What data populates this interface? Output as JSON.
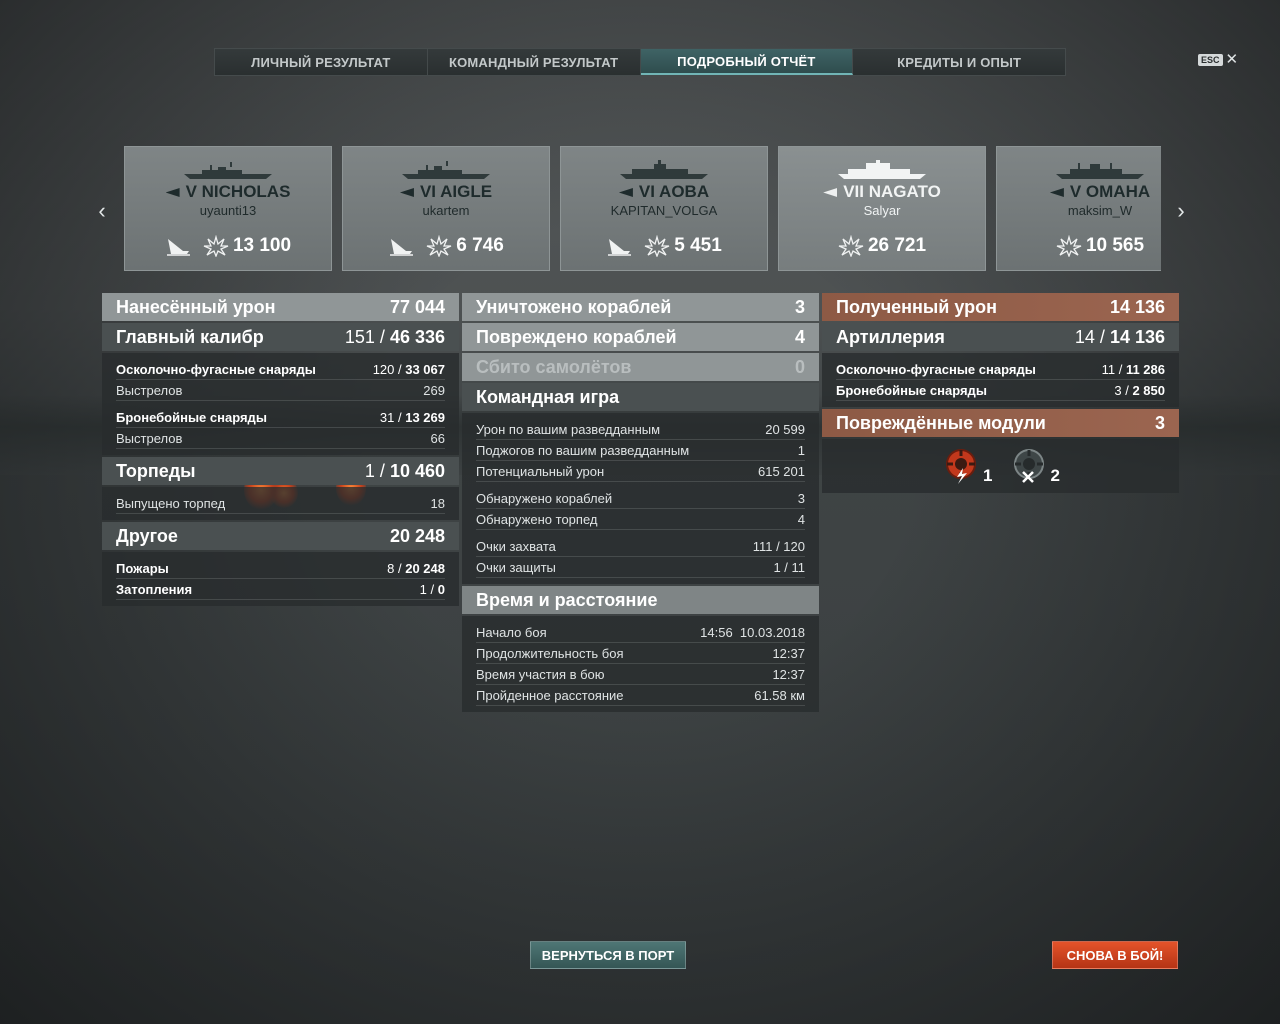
{
  "tabs": [
    "ЛИЧНЫЙ РЕЗУЛЬТАТ",
    "КОМАНДНЫЙ РЕЗУЛЬТАТ",
    "ПОДРОБНЫЙ ОТЧЁТ",
    "КРЕДИТЫ И ОПЫТ"
  ],
  "active_tab": "ПОДРОБНЫЙ ОТЧЁТ",
  "esc_label": "ESC",
  "ships": [
    {
      "name": "V NICHOLAS",
      "player": "uyaunti13",
      "damage": "13 100"
    },
    {
      "name": "VI AIGLE",
      "player": "ukartem",
      "damage": "6 746"
    },
    {
      "name": "VI AOBA",
      "player": "KAPITAN_VOLGA",
      "damage": "5 451"
    },
    {
      "name": "VII NAGATO",
      "player": "Salyar",
      "damage": "26 721"
    },
    {
      "name": "V OMAHA",
      "player": "maksim_W",
      "damage": "10 565"
    }
  ],
  "left": {
    "dealt": {
      "label": "Нанесённый урон",
      "value": "77 044"
    },
    "main": {
      "label": "Главный калибр",
      "hits": "151 /",
      "value": "46 336"
    },
    "he": {
      "label": "Осколочно-фугасные снаряды",
      "hits": "120 /",
      "value": "33 067"
    },
    "he_shots": {
      "label": "Выстрелов",
      "value": "269"
    },
    "ap": {
      "label": "Бронебойные снаряды",
      "hits": "31 /",
      "value": "13 269"
    },
    "ap_shots": {
      "label": "Выстрелов",
      "value": "66"
    },
    "torp": {
      "label": "Торпеды",
      "hits": "1 /",
      "value": "10 460"
    },
    "torp_fired": {
      "label": "Выпущено торпед",
      "value": "18"
    },
    "other": {
      "label": "Другое",
      "value": "20 248"
    },
    "fires": {
      "label": "Пожары",
      "hits": "8 /",
      "value": "20 248"
    },
    "floods": {
      "label": "Затопления",
      "hits": "1 /",
      "value": "0"
    }
  },
  "middle": {
    "destroyed": {
      "label": "Уничтожено кораблей",
      "value": "3"
    },
    "damaged": {
      "label": "Повреждено кораблей",
      "value": "4"
    },
    "planes": {
      "label": "Сбито самолётов",
      "value": "0"
    },
    "team": {
      "label": "Командная игра"
    },
    "spot_dmg": {
      "label": "Урон по вашим разведданным",
      "value": "20 599"
    },
    "spot_fire": {
      "label": "Поджогов по вашим разведданным",
      "value": "1"
    },
    "potential": {
      "label": "Потенциальный урон",
      "value": "615 201"
    },
    "det_ships": {
      "label": "Обнаружено кораблей",
      "value": "3"
    },
    "det_torps": {
      "label": "Обнаружено торпед",
      "value": "4"
    },
    "capture": {
      "label": "Очки захвата",
      "value": "111 / 120"
    },
    "defense": {
      "label": "Очки защиты",
      "value": "1 / 11"
    },
    "time": {
      "label": "Время и расстояние"
    },
    "start": {
      "label": "Начало боя",
      "value": "14:56  10.03.2018"
    },
    "duration": {
      "label": "Продолжительность боя",
      "value": "12:37"
    },
    "participation": {
      "label": "Время участия в бою",
      "value": "12:37"
    },
    "distance": {
      "label": "Пройденное расстояние",
      "value": "61.58 км"
    }
  },
  "right": {
    "received": {
      "label": "Полученный урон",
      "value": "14 136"
    },
    "artillery": {
      "label": "Артиллерия",
      "hits": "14 /",
      "value": "14 136"
    },
    "he": {
      "label": "Осколочно-фугасные снаряды",
      "hits": "11 /",
      "value": "11 286"
    },
    "ap": {
      "label": "Бронебойные снаряды",
      "hits": "3 /",
      "value": "2 850"
    },
    "modules": {
      "label": "Повреждённые модули",
      "value": "3"
    },
    "mod_counts": [
      "1",
      "2"
    ],
    "module_icons": [
      "damaged-module-icon",
      "destroyed-module-icon"
    ]
  },
  "buttons": {
    "port": "ВЕРНУТЬСЯ В ПОРТ",
    "battle": "СНОВА В БОЙ!"
  },
  "colors": {
    "accent_tab": "#3f6365",
    "received_header": "#9b6550",
    "battle_button": "#d44420",
    "port_button": "#426867"
  }
}
